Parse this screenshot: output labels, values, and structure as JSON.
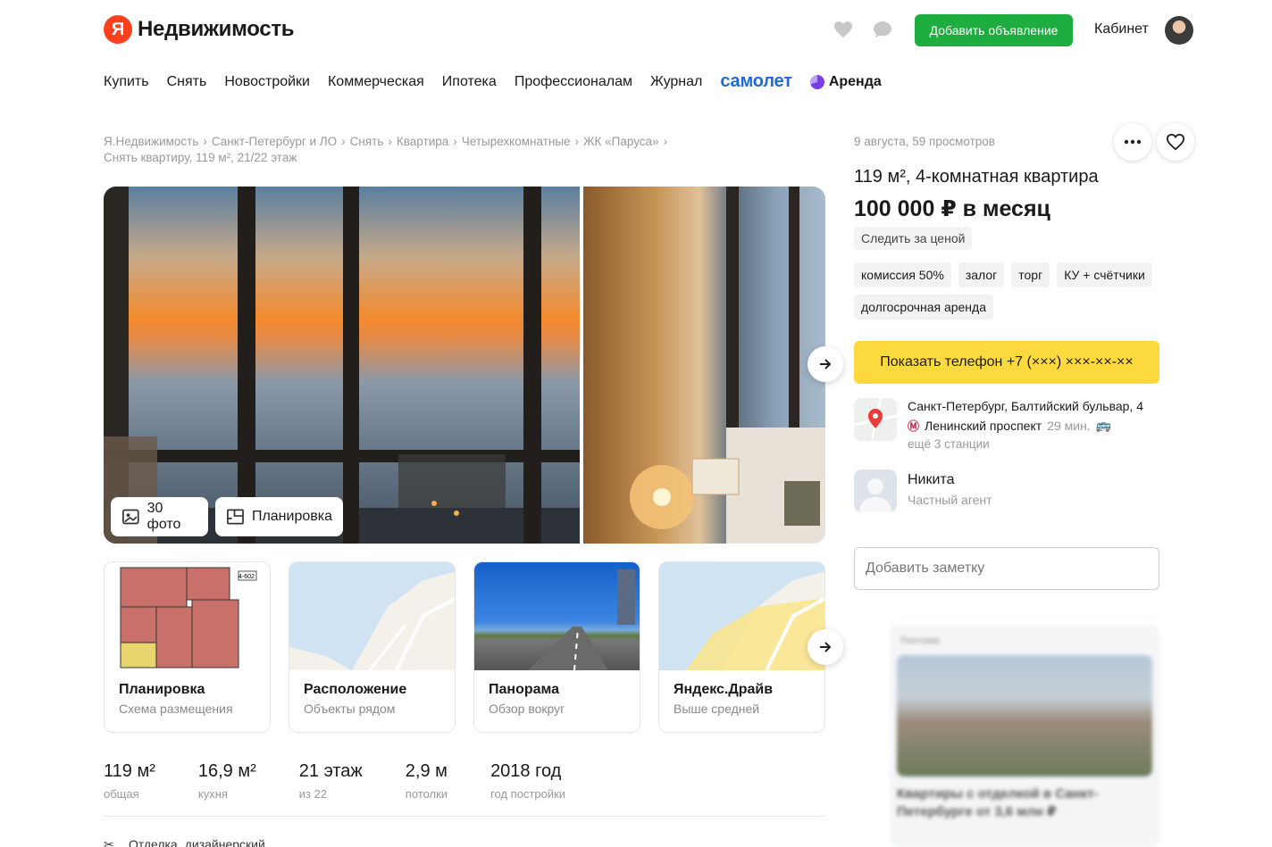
{
  "header": {
    "logo_letter": "Я",
    "logo_text": "Недвижимость",
    "add_listing_label": "Добавить объявление",
    "cabinet_label": "Кабинет"
  },
  "nav": {
    "items": [
      "Купить",
      "Снять",
      "Новостройки",
      "Коммерческая",
      "Ипотека",
      "Профессионалам",
      "Журнал"
    ],
    "samolet": "самолет",
    "arenda": "Аренда"
  },
  "breadcrumbs": [
    "Я.Недвижимость",
    "Санкт-Петербург и ЛО",
    "Снять",
    "Квартира",
    "Четырехкомнатные",
    "ЖК «Паруса»",
    "Снять квартиру, 119 м², 21/22 этаж"
  ],
  "gallery": {
    "photos_label": "30 фото",
    "plan_label": "Планировка"
  },
  "cards": [
    {
      "title": "Планировка",
      "subtitle": "Схема размещения"
    },
    {
      "title": "Расположение",
      "subtitle": "Объекты рядом"
    },
    {
      "title": "Панорама",
      "subtitle": "Обзор вокруг"
    },
    {
      "title": "Яндекс.Драйв",
      "subtitle": "Выше средней"
    }
  ],
  "plan_label": "4-602",
  "stats": [
    {
      "value": "119 м²",
      "label": "общая"
    },
    {
      "value": "16,9 м²",
      "label": "кухня"
    },
    {
      "value": "21 этаж",
      "label": "из 22"
    },
    {
      "value": "2,9 м",
      "label": "потолки"
    },
    {
      "value": "2018 год",
      "label": "год постройки"
    }
  ],
  "details_peek": {
    "label": "Отделка",
    "value": "дизайнерский"
  },
  "offer": {
    "meta": "9 августа, 59 просмотров",
    "title": "119 м², 4-комнатная квартира",
    "price": "100 000 ₽ в месяц",
    "watch_price": "Следить за ценой",
    "tags": [
      "комиссия 50%",
      "залог",
      "торг",
      "КУ + счётчики",
      "долгосрочная аренда"
    ],
    "phone_button": "Показать телефон +7 (×××) ×××-××-××",
    "address": "Санкт-Петербург, Балтийский бульвар, 4",
    "metro_station": "Ленинский проспект",
    "metro_time": "29 мин.",
    "more_stations": "ещё 3 станции",
    "agent_name": "Никита",
    "agent_role": "Частный агент",
    "note_placeholder": "Добавить заметку"
  },
  "ad": {
    "label": "Реклама",
    "text": "Квартиры с отделкой в Санкт-Петербурге от 3,6 млн ₽"
  },
  "colors": {
    "green": "#1eae3f",
    "yellow": "#fcd93c",
    "brand_red": "#fc3f1d",
    "samolet_blue": "#1d6bd9"
  }
}
